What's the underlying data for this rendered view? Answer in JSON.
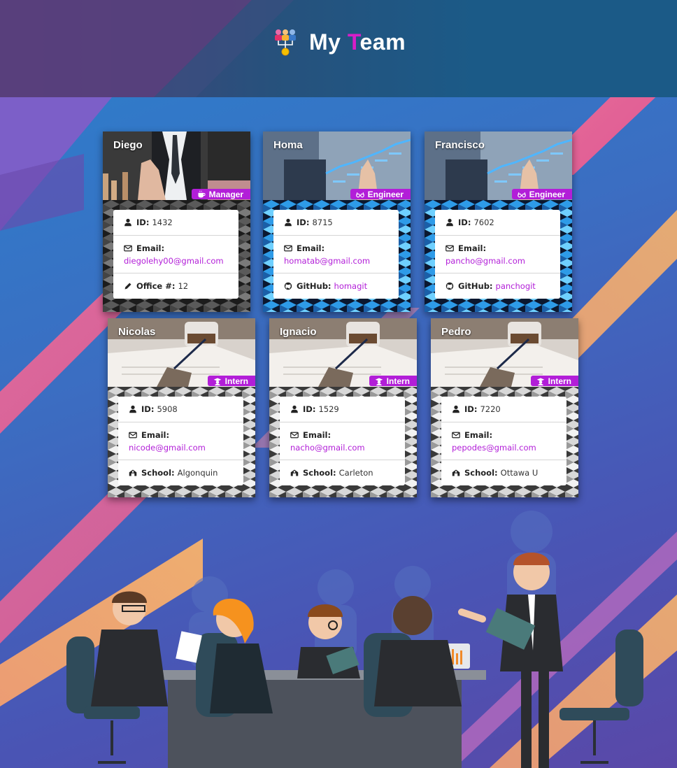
{
  "header": {
    "title_pre": "My ",
    "title_t": "T",
    "title_post": "eam"
  },
  "colors": {
    "accent": "#b21ed8",
    "header_bg": "#1b5a87",
    "page_bg": "#3b6ec2"
  },
  "cards": [
    {
      "name": "Diego",
      "role": "Manager",
      "role_icon": "coffee-icon",
      "id_label": "ID:",
      "id": "1432",
      "email_label": "Email:",
      "email": "diegolehy00@gmail.com",
      "extra_label": "Office #:",
      "extra_value": "12",
      "extra_icon": "pencil-icon"
    },
    {
      "name": "Homa",
      "role": "Engineer",
      "role_icon": "glasses-icon",
      "id_label": "ID:",
      "id": "8715",
      "email_label": "Email:",
      "email": "homatab@gmail.com",
      "extra_label": "GitHub:",
      "extra_value": "homagit",
      "extra_icon": "github-icon"
    },
    {
      "name": "Francisco",
      "role": "Engineer",
      "role_icon": "glasses-icon",
      "id_label": "ID:",
      "id": "7602",
      "email_label": "Email:",
      "email": "pancho@gmail.com",
      "extra_label": "GitHub:",
      "extra_value": "panchogit",
      "extra_icon": "github-icon"
    },
    {
      "name": "Nicolas",
      "role": "Intern",
      "role_icon": "graduate-icon",
      "id_label": "ID:",
      "id": "5908",
      "email_label": "Email:",
      "email": "nicode@gmail.com",
      "extra_label": "School:",
      "extra_value": "Algonquin",
      "extra_icon": "school-icon"
    },
    {
      "name": "Ignacio",
      "role": "Intern",
      "role_icon": "graduate-icon",
      "id_label": "ID:",
      "id": "1529",
      "email_label": "Email:",
      "email": "nacho@gmail.com",
      "extra_label": "School:",
      "extra_value": "Carleton",
      "extra_icon": "school-icon"
    },
    {
      "name": "Pedro",
      "role": "Intern",
      "role_icon": "graduate-icon",
      "id_label": "ID:",
      "id": "7220",
      "email_label": "Email:",
      "email": "pepodes@gmail.com",
      "extra_label": "School:",
      "extra_value": "Ottawa U",
      "extra_icon": "school-icon"
    }
  ]
}
